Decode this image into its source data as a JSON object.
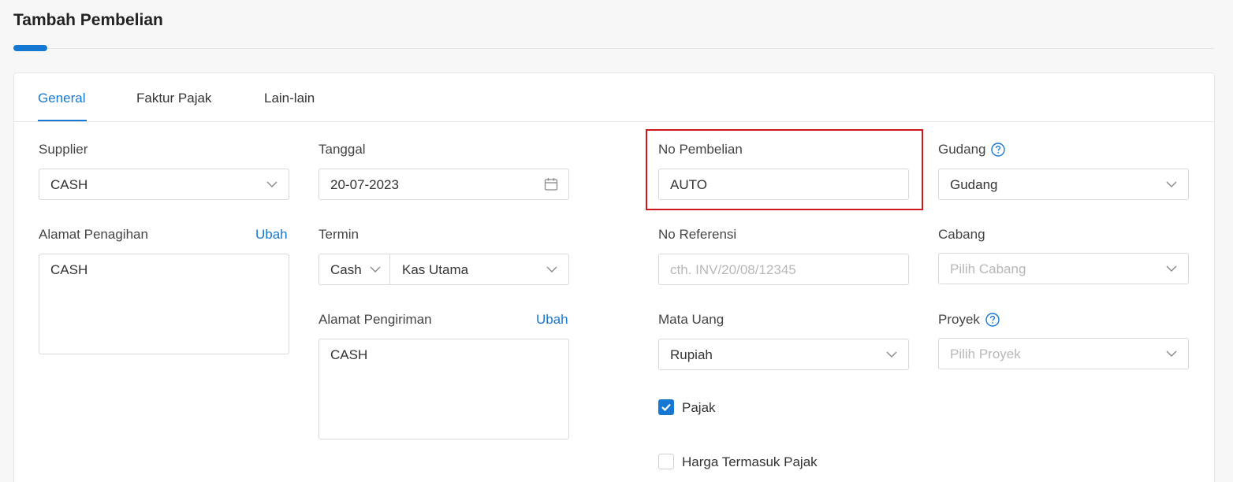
{
  "page": {
    "title": "Tambah Pembelian"
  },
  "tabs": [
    {
      "label": "General",
      "active": true
    },
    {
      "label": "Faktur Pajak",
      "active": false
    },
    {
      "label": "Lain-lain",
      "active": false
    }
  ],
  "supplier": {
    "label": "Supplier",
    "value": "CASH"
  },
  "alamat_penagihan": {
    "label": "Alamat Penagihan",
    "edit_label": "Ubah",
    "value": "CASH"
  },
  "tanggal": {
    "label": "Tanggal",
    "value": "20-07-2023"
  },
  "termin": {
    "label": "Termin",
    "type_value": "Cash",
    "account_value": "Kas Utama"
  },
  "alamat_pengiriman": {
    "label": "Alamat Pengiriman",
    "edit_label": "Ubah",
    "value": "CASH"
  },
  "no_pembelian": {
    "label": "No Pembelian",
    "value": "AUTO"
  },
  "no_referensi": {
    "label": "No Referensi",
    "placeholder": "cth. INV/20/08/12345"
  },
  "mata_uang": {
    "label": "Mata Uang",
    "value": "Rupiah"
  },
  "pajak": {
    "label": "Pajak",
    "checked": true
  },
  "harga_termasuk_pajak": {
    "label": "Harga Termasuk Pajak",
    "checked": false
  },
  "gudang": {
    "label": "Gudang",
    "value": "Gudang"
  },
  "cabang": {
    "label": "Cabang",
    "placeholder": "Pilih Cabang"
  },
  "proyek": {
    "label": "Proyek",
    "placeholder": "Pilih Proyek"
  },
  "colors": {
    "accent": "#1778d3",
    "highlight": "#d0161c"
  }
}
